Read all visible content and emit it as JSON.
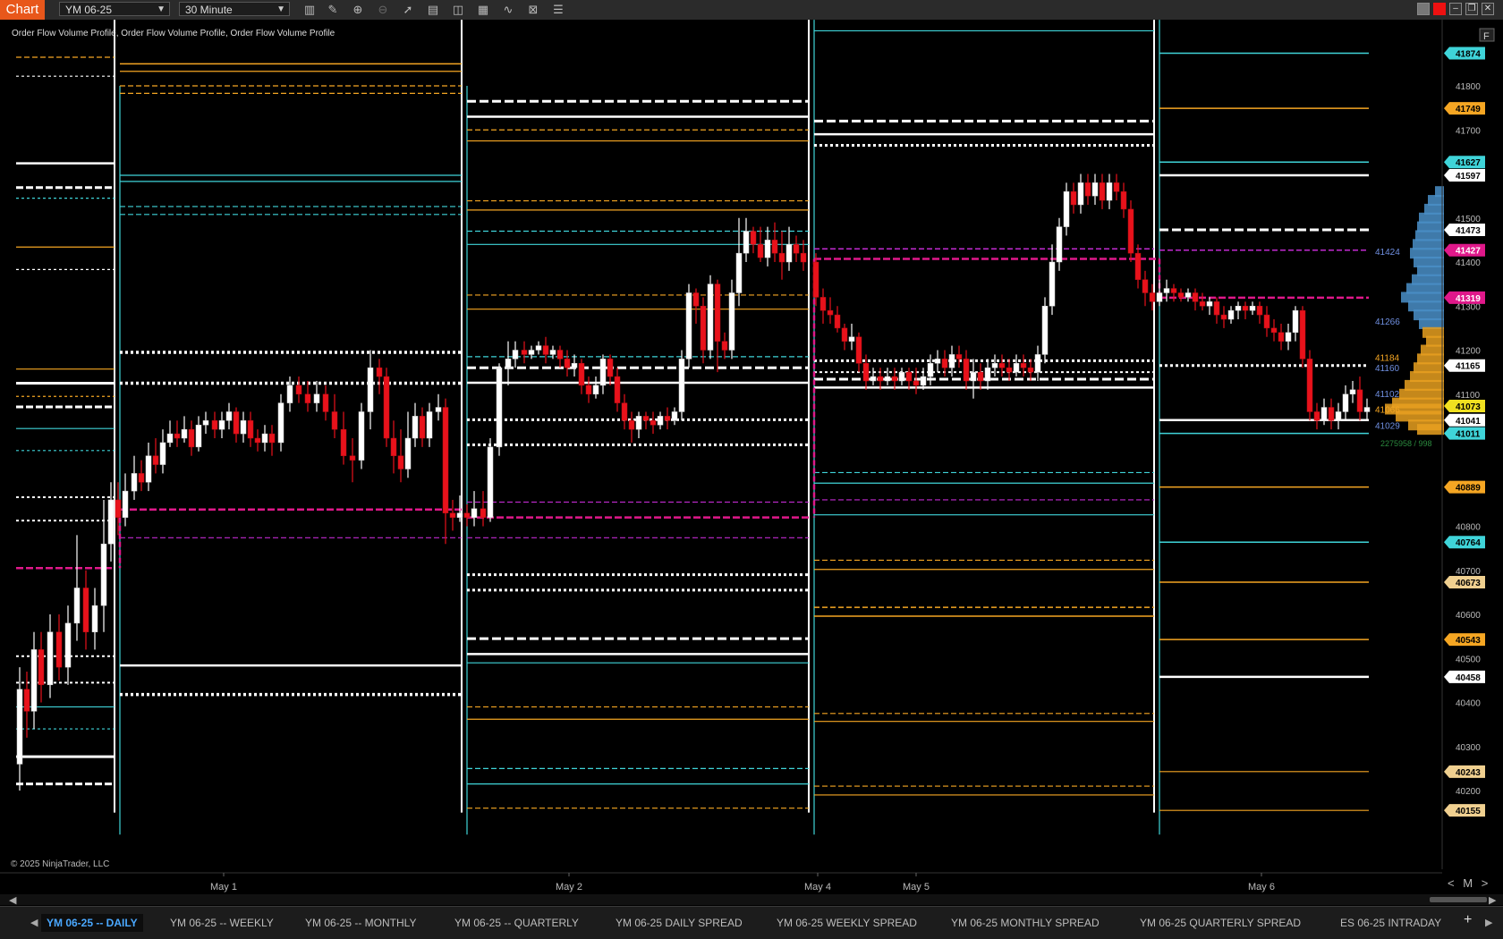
{
  "toolbar": {
    "chart_label": "Chart",
    "instrument": "YM 06-25",
    "interval": "30 Minute",
    "icons": [
      "bar-style-icon",
      "draw-pencil-icon",
      "zoom-in-icon",
      "zoom-out-icon",
      "pointer-icon",
      "data-box-icon",
      "split-panel-icon",
      "indicators-icon",
      "strategy-icon",
      "properties-icon",
      "chart-trader-icon"
    ]
  },
  "window_controls": [
    "restore-icon",
    "close-red-icon",
    "minimize-icon",
    "maximize-icon",
    "close-icon"
  ],
  "chart": {
    "indicator_label": "Order Flow Volume Profile, Order Flow Volume Profile, Order Flow Volume Profile",
    "copyright": "© 2025 NinjaTrader, LLC",
    "corner_button": "F",
    "colors": {
      "background": "#000000",
      "up": "#ffffff",
      "down": "#e8121b",
      "white": "#ffffff",
      "orange": "#f5a623",
      "cyan": "#3fd4d9",
      "magenta": "#e0188a",
      "purple": "#c12ad0"
    },
    "y_ticks": [
      "41800",
      "41700",
      "41500",
      "41400",
      "41300",
      "41200",
      "41100",
      "40800",
      "40700",
      "40600",
      "40500",
      "40400",
      "40300",
      "40200"
    ],
    "x_ticks": [
      "May 1",
      "May 2",
      "May 4",
      "May 5",
      "May 6"
    ],
    "price_markers": [
      {
        "value": "41874",
        "color": "#3fd4d9",
        "text_color": "#000"
      },
      {
        "value": "41749",
        "color": "#f5a623",
        "text_color": "#000"
      },
      {
        "value": "41627",
        "color": "#3fd4d9",
        "text_color": "#000"
      },
      {
        "value": "41597",
        "color": "#ffffff",
        "text_color": "#000"
      },
      {
        "value": "41473",
        "color": "#ffffff",
        "text_color": "#000"
      },
      {
        "value": "41427",
        "color": "#e0188a",
        "text_color": "#fff"
      },
      {
        "value": "41319",
        "color": "#e0188a",
        "text_color": "#fff"
      },
      {
        "value": "41165",
        "color": "#ffffff",
        "text_color": "#000"
      },
      {
        "value": "41073",
        "color": "#f0e020",
        "text_color": "#000"
      },
      {
        "value": "41041",
        "color": "#ffffff",
        "text_color": "#000"
      },
      {
        "value": "41011",
        "color": "#3fd4d9",
        "text_color": "#000"
      },
      {
        "value": "40889",
        "color": "#f5a623",
        "text_color": "#000"
      },
      {
        "value": "40764",
        "color": "#3fd4d9",
        "text_color": "#000"
      },
      {
        "value": "40673",
        "color": "#f0d090",
        "text_color": "#000"
      },
      {
        "value": "40543",
        "color": "#f5a623",
        "text_color": "#000"
      },
      {
        "value": "40458",
        "color": "#ffffff",
        "text_color": "#000"
      },
      {
        "value": "40243",
        "color": "#f0d090",
        "text_color": "#000"
      },
      {
        "value": "40155",
        "color": "#f0d090",
        "text_color": "#000"
      }
    ],
    "profile_labels": [
      {
        "value": "41424",
        "color": "#6f8fe0"
      },
      {
        "value": "41266",
        "color": "#6f8fe0"
      },
      {
        "value": "41184",
        "color": "#f5a623"
      },
      {
        "value": "41160",
        "color": "#6f8fe0"
      },
      {
        "value": "41102",
        "color": "#6f8fe0"
      },
      {
        "value": "41066",
        "color": "#f5a623"
      },
      {
        "value": "41029",
        "color": "#6f8fe0"
      }
    ],
    "profile_footer": "2275958 / 998"
  },
  "bottom_tabs": [
    {
      "label": "YM 06-25 -- DAILY",
      "active": true
    },
    {
      "label": "YM 06-25 -- WEEKLY",
      "active": false
    },
    {
      "label": "YM 06-25 -- MONTHLY",
      "active": false
    },
    {
      "label": "YM 06-25 -- QUARTERLY",
      "active": false
    },
    {
      "label": "YM 06-25 DAILY SPREAD",
      "active": false
    },
    {
      "label": "YM 06-25 WEEKLY SPREAD",
      "active": false
    },
    {
      "label": "YM 06-25 MONTHLY SPREAD",
      "active": false
    },
    {
      "label": "YM 06-25 QUARTERLY SPREAD",
      "active": false
    },
    {
      "label": "ES 06-25 INTRADAY",
      "active": false
    }
  ],
  "bottom_controls": {
    "add": "+",
    "next": "▶",
    "prev": "◀",
    "zoom_label": "M"
  }
}
